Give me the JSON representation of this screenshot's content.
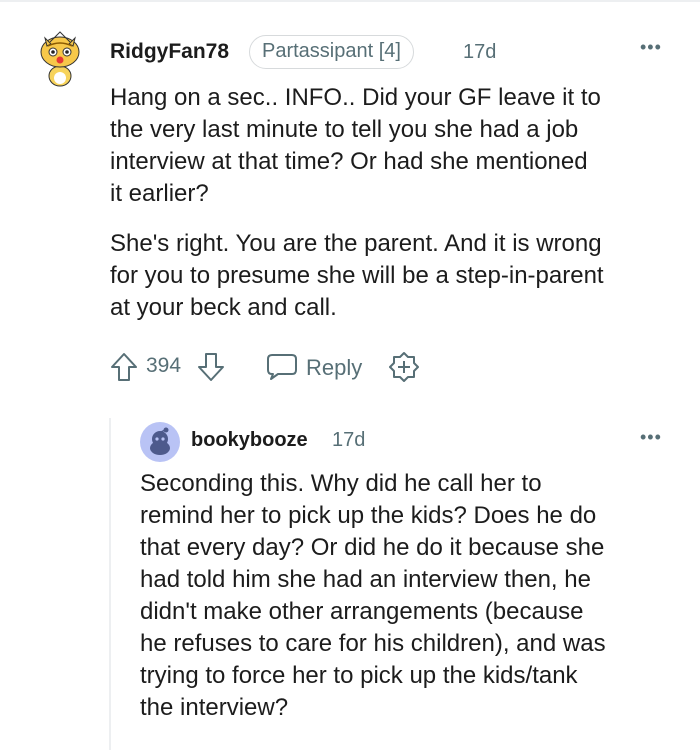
{
  "comment": {
    "username": "RidgyFan78",
    "flair": "Partassipant [4]",
    "time": "17d",
    "more_label": "•••",
    "paragraph1": "Hang on a sec.. INFO.. Did your GF leave it to\nthe very last minute to tell you she had a job\ninterview at that time? Or had she mentioned\nit earlier?",
    "paragraph2": "She's right. You are the parent. And it is wrong\nfor you to presume she will be a step-in-parent\nat your beck and call.",
    "score": "394",
    "reply_label": "Reply",
    "icons": {
      "avatar": "snoo-avatar-yellow-icon",
      "upvote": "upvote-arrow-icon",
      "downvote": "downvote-arrow-icon",
      "reply": "speech-bubble-icon",
      "award": "award-plus-icon"
    }
  },
  "reply": {
    "username": "bookybooze",
    "time": "17d",
    "more_label": "•••",
    "body": "Seconding this. Why did he call her to\nremind her to pick up the kids? Does he do\nthat every day? Or did he do it because she\nhad told him she had an interview then, he\ndidn't make other arrangements (because\nhe refuses to care for his children), and was\ntrying to force her to pick up the kids/tank\nthe interview?",
    "icons": {
      "avatar": "default-snoo-avatar-icon"
    }
  },
  "colors": {
    "text": "#1c1c1c",
    "meta": "#576f76",
    "border": "#d7dadc",
    "thread_line": "#edeff1",
    "avatar_bg": "#b9c3f5"
  }
}
